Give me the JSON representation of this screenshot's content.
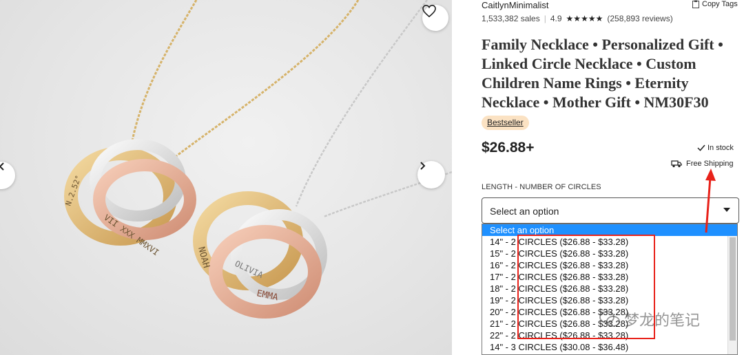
{
  "shop": {
    "name": "CaitlynMinimalist",
    "copy_tags_label": "Copy Tags",
    "sales": "1,533,382 sales",
    "rating": "4.9",
    "stars": "★★★★★",
    "reviews": "(258,893 reviews)"
  },
  "product": {
    "title": "Family Necklace • Personalized Gift • Linked Circle Necklace • Custom Children Name Rings • Eternity Necklace • Mother Gift • NM30F30",
    "badge": "Bestseller",
    "price": "$26.88+",
    "stock": "In stock",
    "shipping": "Free Shipping"
  },
  "photo": {
    "engravings": [
      "NOAH",
      "OLIVIA",
      "EMMA",
      "VII XXX MMXVI",
      "N.2.52°"
    ],
    "icons": {
      "favorite": "heart-icon",
      "prev": "chevron-left-icon",
      "next": "chevron-right-icon"
    }
  },
  "variation": {
    "label": "LENGTH - NUMBER OF CIRCLES",
    "selected": "Select an option",
    "options": [
      "Select an option",
      "14\" - 2 CIRCLES ($26.88 - $33.28)",
      "15\" - 2 CIRCLES ($26.88 - $33.28)",
      "16\" - 2 CIRCLES ($26.88 - $33.28)",
      "17\" - 2 CIRCLES ($26.88 - $33.28)",
      "18\" - 2 CIRCLES ($26.88 - $33.28)",
      "19\" - 2 CIRCLES ($26.88 - $33.28)",
      "20\" - 2 CIRCLES ($26.88 - $33.28)",
      "21\" - 2 CIRCLES ($26.88 - $33.28)",
      "22\" - 2 CIRCLES ($26.88 - $33.28)",
      "14\" - 3 CIRCLES ($30.08 - $36.48)"
    ]
  },
  "watermark": "梦龙的笔记",
  "colors": {
    "annotation_red": "#e8221a",
    "selected_blue": "#1e90ff",
    "badge_bg": "#fbe2c3"
  }
}
